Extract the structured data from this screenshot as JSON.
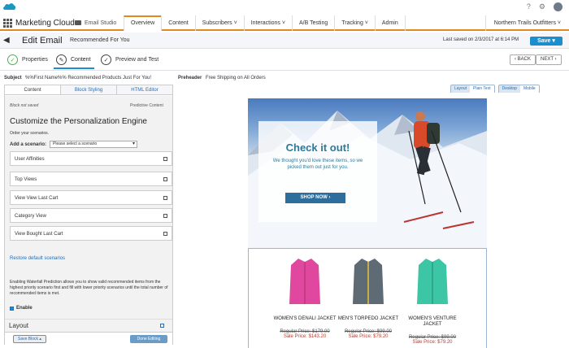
{
  "topbar": {
    "help_icon": "question-icon",
    "settings_icon": "gear-icon"
  },
  "nav": {
    "app_title": "Marketing Cloud",
    "studio": "Email Studio",
    "tabs": [
      "Overview",
      "Content",
      "Subscribers",
      "Interactions",
      "A/B Testing",
      "Tracking",
      "Admin"
    ],
    "tab_dropdowns": [
      "",
      "",
      "˅",
      "˅",
      "",
      "˅",
      ""
    ],
    "account": "Northern Trails Outfitters ˅"
  },
  "edit": {
    "title": "Edit Email",
    "subtitle": "Recommended For You",
    "last_saved": "Last saved on 2/3/2017 at 6:14 PM",
    "save_label": "Save"
  },
  "steps": {
    "properties": "Properties",
    "content": "Content",
    "preview": "Preview and Test",
    "back": "‹ BACK",
    "next": "NEXT ›"
  },
  "subject": {
    "label": "Subject",
    "value": "%%First Name%% Recommended Products Just For You!",
    "preheader_label": "Preheader",
    "preheader_value": "Free Shipping on All Orders"
  },
  "panel": {
    "tabs": [
      "Content",
      "Block Styling",
      "HTML Editor"
    ],
    "block_status": "Block not saved",
    "block_type": "Predictive Content",
    "title": "Customize the Personalization Engine",
    "order_text": "Order your scenarios.",
    "add_label": "Add a scenario:",
    "select_placeholder": "Please select a scenario",
    "scenarios": [
      "User Affinities",
      "Top Views",
      "View View Last Cart",
      "Category View",
      "View Bought Last Cart"
    ],
    "restore": "Restore default scenarios",
    "waterfall_text": "Enabling Waterfall Prediction allows you to show valid recommended items from the highest priority scenario first and fill with lower priority scenarios until the total number of recommended items is met.",
    "enable_label": "Enable",
    "layout_label": "Layout",
    "save_block": "Save Block ▴",
    "done_editing": "Done Editing"
  },
  "view_toggles": {
    "layout": "Layout",
    "plain_text": "Plain Text",
    "desktop": "Desktop",
    "mobile": "Mobile"
  },
  "hero": {
    "title": "Check it out!",
    "subtitle": "We thought you'd love these items, so we picked them out just for you.",
    "button": "SHOP NOW ›"
  },
  "products": [
    {
      "name": "WOMEN'S DENALI JACKET",
      "regular": "Regular Price: $179.00",
      "sale": "Sale Price: $143.20",
      "color": "#e0479e"
    },
    {
      "name": "MEN'S TORPEDO JACKET",
      "regular": "Regular Price: $99.00",
      "sale": "Sale Price: $79.20",
      "color": "#5f6b74"
    },
    {
      "name": "WOMEN'S VENTURE JACKET",
      "regular": "Regular Price: $99.00",
      "sale": "Sale Price: $79.20",
      "color": "#3cc6a6"
    }
  ],
  "colors": {
    "accent": "#e08a1e",
    "brand": "#1b8ed0",
    "link": "#1b6ec2",
    "hero_text": "#2a7a9c"
  }
}
